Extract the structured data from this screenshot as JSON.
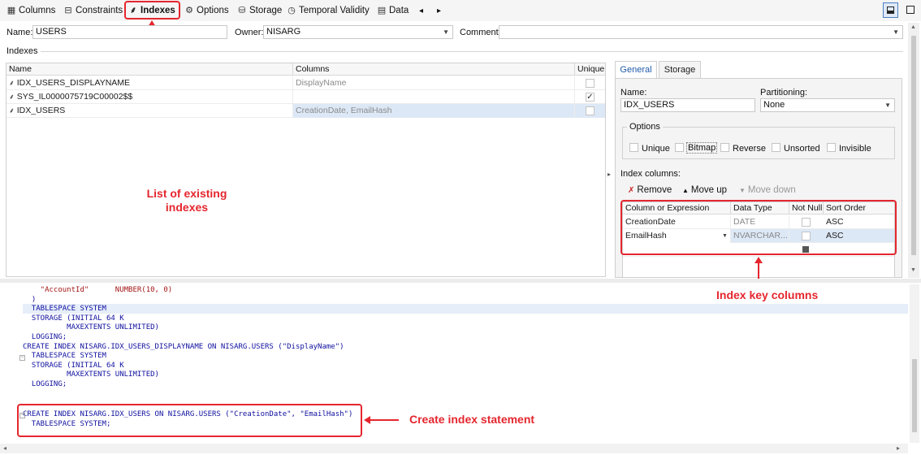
{
  "toolbar": {
    "tabs": [
      {
        "label": "Columns",
        "icon": "columns-grid-icon"
      },
      {
        "label": "Constraints",
        "icon": "constraints-icon"
      },
      {
        "label": "Indexes",
        "icon": "index-tree-icon"
      },
      {
        "label": "Options",
        "icon": "gear-icon"
      },
      {
        "label": "Storage",
        "icon": "database-icon"
      },
      {
        "label": "Temporal Validity",
        "icon": "clock-icon"
      },
      {
        "label": "Data",
        "icon": "table-icon"
      }
    ],
    "nav_prev": "◂",
    "nav_next": "▸"
  },
  "header": {
    "name_label": "Name:",
    "name_value": "USERS",
    "owner_label": "Owner:",
    "owner_value": "NISARG",
    "comment_label": "Comment:",
    "comment_value": ""
  },
  "indexes": {
    "section_label": "Indexes",
    "columns": [
      "Name",
      "Columns",
      "Unique"
    ],
    "rows": [
      {
        "name": "IDX_USERS_DISPLAYNAME",
        "columns": "DisplayName",
        "unique": false
      },
      {
        "name": "SYS_IL0000075719C00002$$",
        "columns": "",
        "unique": true
      },
      {
        "name": "IDX_USERS",
        "columns": "CreationDate, EmailHash",
        "unique": false
      }
    ]
  },
  "details": {
    "tabs": [
      "General",
      "Storage"
    ],
    "name_label": "Name:",
    "name_value": "IDX_USERS",
    "partitioning_label": "Partitioning:",
    "partitioning_value": "None",
    "options_label": "Options",
    "options": [
      {
        "label": "Unique",
        "checked": false
      },
      {
        "label": "Bitmap",
        "checked": false
      },
      {
        "label": "Reverse",
        "checked": false
      },
      {
        "label": "Unsorted",
        "checked": false
      },
      {
        "label": "Invisible",
        "checked": false
      }
    ],
    "index_columns_label": "Index columns:",
    "actions": [
      "Remove",
      "Move up",
      "Move down"
    ],
    "key_columns_headers": [
      "Column or Expression",
      "Data Type",
      "Not Null",
      "Sort Order"
    ],
    "key_columns": [
      {
        "column": "CreationDate",
        "type": "DATE",
        "not_null": false,
        "sort": "ASC"
      },
      {
        "column": "EmailHash",
        "type": "NVARCHAR...",
        "not_null": false,
        "sort": "ASC"
      }
    ]
  },
  "code": {
    "lines_top": [
      "    \"AccountId\"      NUMBER(10, 0)",
      "  )",
      "  TABLESPACE SYSTEM",
      "  STORAGE (INITIAL 64 K",
      "          MAXEXTENTS UNLIMITED)",
      "  LOGGING;",
      "",
      "CREATE INDEX NISARG.IDX_USERS_DISPLAYNAME ON NISARG.USERS (\"DisplayName\")",
      "  TABLESPACE SYSTEM",
      "  STORAGE (INITIAL 64 K",
      "          MAXEXTENTS UNLIMITED)",
      "  LOGGING;"
    ],
    "lines_bottom": [
      "CREATE INDEX NISARG.IDX_USERS ON NISARG.USERS (\"CreationDate\", \"EmailHash\")",
      "  TABLESPACE SYSTEM;"
    ]
  },
  "annotations": {
    "list_existing": "List of existing\nindexes",
    "key_columns": "Index key columns",
    "create_statement": "Create index statement"
  },
  "colors": {
    "accent_red": "#e5262e",
    "selection": "#dde8f6",
    "link_blue": "#1f5aa8"
  }
}
